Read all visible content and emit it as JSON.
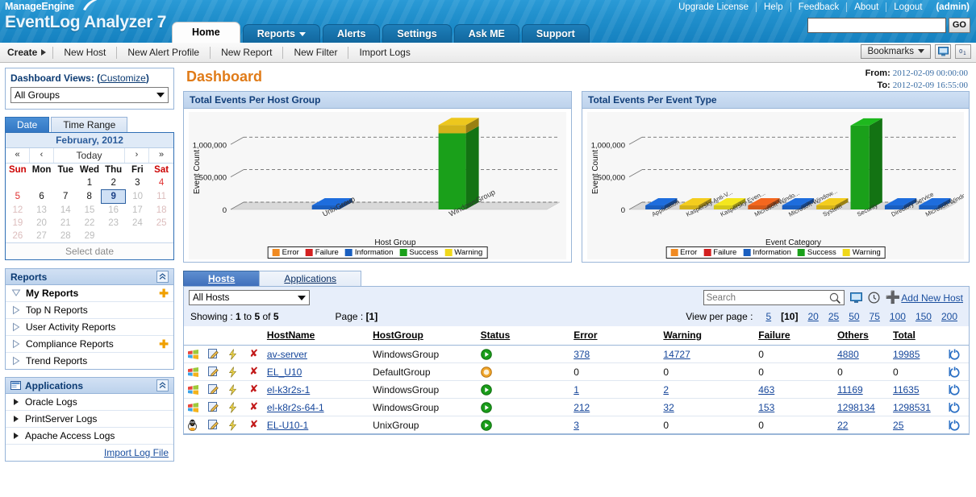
{
  "header": {
    "brand_line1": "ManageEngine",
    "brand_line2": "EventLog Analyzer 7",
    "topnav": [
      "Upgrade License",
      "Help",
      "Feedback",
      "About",
      "Logout"
    ],
    "user": "(admin)",
    "search_value": "",
    "go_label": "GO",
    "tabs": [
      {
        "label": "Home",
        "active": true,
        "caret": false
      },
      {
        "label": "Reports",
        "active": false,
        "caret": true
      },
      {
        "label": "Alerts",
        "active": false,
        "caret": false
      },
      {
        "label": "Settings",
        "active": false,
        "caret": false
      },
      {
        "label": "Ask ME",
        "active": false,
        "caret": false
      },
      {
        "label": "Support",
        "active": false,
        "caret": false
      }
    ]
  },
  "toolbar": {
    "create_label": "Create",
    "items": [
      "New Host",
      "New Alert Profile",
      "New Report",
      "New Filter",
      "Import Logs"
    ],
    "bookmarks_label": "Bookmarks"
  },
  "sidebar": {
    "dashboard_views": {
      "title": "Dashboard Views:",
      "customize": "Customize",
      "selected": "All Groups"
    },
    "date_tabs": [
      {
        "label": "Date",
        "active": true
      },
      {
        "label": "Time Range",
        "active": false
      }
    ],
    "calendar": {
      "month": "February, 2012",
      "nav": [
        "«",
        "‹",
        "Today",
        "›",
        "»"
      ],
      "today_label": "Today",
      "weekdays": [
        "Sun",
        "Mon",
        "Tue",
        "Wed",
        "Thu",
        "Fri",
        "Sat"
      ],
      "selected_day": 9,
      "last_active_day": 9,
      "days_in_month": 29,
      "first_weekday_index": 3,
      "footer": "Select date"
    },
    "reports": {
      "title": "Reports",
      "items": [
        {
          "label": "My Reports",
          "bold": true,
          "expanded": true,
          "plus": true
        },
        {
          "label": "Top N Reports",
          "bold": false,
          "expanded": false,
          "plus": false
        },
        {
          "label": "User Activity Reports",
          "bold": false,
          "expanded": false,
          "plus": false
        },
        {
          "label": "Compliance Reports",
          "bold": false,
          "expanded": false,
          "plus": true
        },
        {
          "label": "Trend Reports",
          "bold": false,
          "expanded": false,
          "plus": false
        }
      ]
    },
    "applications": {
      "title": "Applications",
      "items": [
        "Oracle Logs",
        "PrintServer Logs",
        "Apache Access Logs"
      ],
      "import_link": "Import Log File"
    }
  },
  "main": {
    "page_title": "Dashboard",
    "from_label": "From:",
    "from_value": "2012-02-09 00:00:00",
    "to_label": "To:",
    "to_value": "2012-02-09 16:55:00"
  },
  "chart_data": [
    {
      "type": "bar",
      "title": "Total Events Per Host Group",
      "xlabel": "Host Group",
      "ylabel": "Event Count",
      "categories": [
        "UnixGroup",
        "WindowsGroup"
      ],
      "ylim": [
        0,
        1400000
      ],
      "yticks": [
        0,
        500000,
        1000000
      ],
      "ytick_labels": [
        "0",
        "500,000",
        "1,000,000"
      ],
      "grid": true,
      "legend": [
        "Error",
        "Failure",
        "Information",
        "Success",
        "Warning"
      ],
      "legend_colors": [
        "#f08a22",
        "#d42020",
        "#1a5fc0",
        "#1aa01a",
        "#f0d81a"
      ],
      "legend_position": "bottom",
      "bars": [
        {
          "category": "UnixGroup",
          "value": 25,
          "color": "#1a5fc0",
          "series": "Information"
        },
        {
          "category": "WindowsGroup",
          "value": 1298531,
          "color": "#1aa01a",
          "series": "Success",
          "cap_color": "#d4b21a",
          "cap_series": "Warning"
        }
      ]
    },
    {
      "type": "bar",
      "title": "Total Events Per Event Type",
      "xlabel": "Event Category",
      "ylabel": "Event Count",
      "categories": [
        "Application",
        "Kaspersky Anti-V...",
        "Kaspersky Even...",
        "Microsoft-Windo...",
        "Microsoft-Window...",
        "System",
        "Security",
        "Directory Service",
        "Microsoft-Window..."
      ],
      "ylim": [
        0,
        1400000
      ],
      "yticks": [
        0,
        500000,
        1000000
      ],
      "ytick_labels": [
        "0",
        "500,000",
        "1,000,000"
      ],
      "grid": true,
      "legend": [
        "Error",
        "Failure",
        "Information",
        "Success",
        "Warning"
      ],
      "legend_colors": [
        "#f08a22",
        "#d42020",
        "#1a5fc0",
        "#1aa01a",
        "#f0d81a"
      ],
      "legend_position": "bottom",
      "bars": [
        {
          "category": "Application",
          "value": 2000,
          "color": "#1a5fc0",
          "series": "Information"
        },
        {
          "category": "Kaspersky Anti-V...",
          "value": 2000,
          "color": "#d4b21a",
          "series": "Warning"
        },
        {
          "category": "Kaspersky Even...",
          "value": 2000,
          "color": "#d4c81a",
          "series": "Warning"
        },
        {
          "category": "Microsoft-Windo...",
          "value": 2000,
          "color": "#d45a1a",
          "series": "Error"
        },
        {
          "category": "Microsoft-Window...",
          "value": 2000,
          "color": "#1a5fc0",
          "series": "Information"
        },
        {
          "category": "System",
          "value": 2000,
          "color": "#d4b21a",
          "series": "Warning"
        },
        {
          "category": "Security",
          "value": 1290000,
          "color": "#1aa01a",
          "series": "Success"
        },
        {
          "category": "Directory Service",
          "value": 2000,
          "color": "#1a5fc0",
          "series": "Information"
        },
        {
          "category": "Microsoft-Window...",
          "value": 2000,
          "color": "#1a5fc0",
          "series": "Information"
        }
      ]
    }
  ],
  "hosts_section": {
    "tabs": [
      {
        "label": "Hosts",
        "active": true
      },
      {
        "label": "Applications",
        "active": false
      }
    ],
    "filter_selected": "All Hosts",
    "search_placeholder": "Search",
    "search_value": "",
    "add_new_host": "Add New Host",
    "showing_prefix": "Showing :",
    "showing_from": "1",
    "showing_to": "5",
    "showing_total": "5",
    "showing_mid": "to",
    "showing_of": "of",
    "page_label": "Page :",
    "page_current": "[1]",
    "view_per_page_label": "View per page :",
    "page_sizes": [
      "5",
      "10",
      "20",
      "25",
      "50",
      "75",
      "100",
      "150",
      "200"
    ],
    "page_size_current": "10",
    "columns": [
      "HostName",
      "HostGroup",
      "Status",
      "Error",
      "Warning",
      "Failure",
      "Others",
      "Total"
    ],
    "rows": [
      {
        "os": "windows",
        "hostname": "av-server",
        "hostgroup": "WindowsGroup",
        "status": "up",
        "error": "378",
        "warning": "14727",
        "failure": "0",
        "others": "4880",
        "total": "19985",
        "links": {
          "error": true,
          "warning": true,
          "failure": false,
          "others": true,
          "total": true
        }
      },
      {
        "os": "windows",
        "hostname": "EL_U10",
        "hostgroup": "DefaultGroup",
        "status": "warn",
        "error": "0",
        "warning": "0",
        "failure": "0",
        "others": "0",
        "total": "0",
        "links": {
          "error": false,
          "warning": false,
          "failure": false,
          "others": false,
          "total": false
        }
      },
      {
        "os": "windows",
        "hostname": "el-k3r2s-1",
        "hostgroup": "WindowsGroup",
        "status": "up",
        "error": "1",
        "warning": "2",
        "failure": "463",
        "others": "11169",
        "total": "11635",
        "links": {
          "error": true,
          "warning": true,
          "failure": true,
          "others": true,
          "total": true
        }
      },
      {
        "os": "windows",
        "hostname": "el-k8r2s-64-1",
        "hostgroup": "WindowsGroup",
        "status": "up",
        "error": "212",
        "warning": "32",
        "failure": "153",
        "others": "1298134",
        "total": "1298531",
        "links": {
          "error": true,
          "warning": true,
          "failure": true,
          "others": true,
          "total": true
        }
      },
      {
        "os": "linux",
        "hostname": "EL-U10-1",
        "hostgroup": "UnixGroup",
        "status": "up",
        "error": "3",
        "warning": "0",
        "failure": "0",
        "others": "22",
        "total": "25",
        "links": {
          "error": true,
          "warning": false,
          "failure": false,
          "others": true,
          "total": true
        }
      }
    ]
  },
  "colors": {
    "brand_blue": "#1f8ecb",
    "accent_orange": "#e07b18",
    "panel_blue": "#96b4d8",
    "status_up": "#1a9c1a",
    "status_warn": "#e8941a"
  }
}
